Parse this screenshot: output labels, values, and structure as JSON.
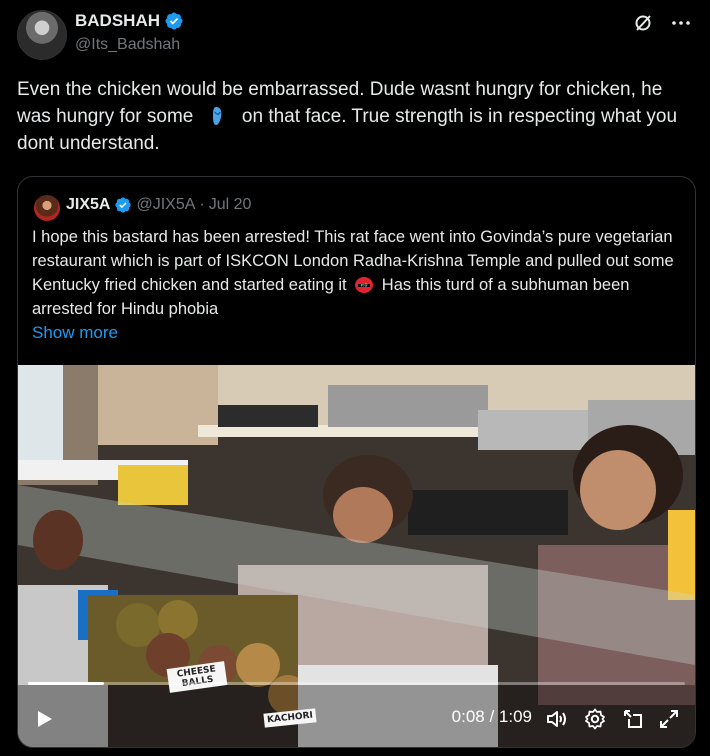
{
  "author": {
    "name": "BADSHAH",
    "handle": "@Its_Badshah"
  },
  "tweet": {
    "text_part1": "Even the chicken would be embarrassed. Dude wasnt hungry for chicken, he was hungry for some",
    "text_part2": "on that face. True strength is in respecting what you dont understand."
  },
  "quote": {
    "name": "JIX5A",
    "handle": "@JIX5A",
    "dot": "·",
    "date": "Jul 20",
    "text_part1": "I hope this bastard has been arrested!  This rat face went into Govinda’s pure vegetarian restaurant  which is part of ISKCON London Radha-Krishna Temple and pulled out some Kentucky fried chicken and started eating it",
    "text_part2": "Has this turd of a subhuman been arrested for Hindu phobia",
    "show_more": "Show more"
  },
  "video": {
    "time": "0:08 / 1:09",
    "progress": 0.116,
    "sign_cheese": "CHEESE BALLS",
    "sign_kachori": "KACHORI"
  },
  "colors": {
    "accent": "#1d9bf0",
    "text": "#e7e9ea",
    "muted": "#71767b",
    "border": "#2f3336"
  },
  "icons": [
    "verified-icon",
    "grok-icon",
    "more-icon",
    "sandal-emoji",
    "angry-emoji",
    "play-icon",
    "volume-icon",
    "settings-icon",
    "pip-icon",
    "fullscreen-icon"
  ]
}
